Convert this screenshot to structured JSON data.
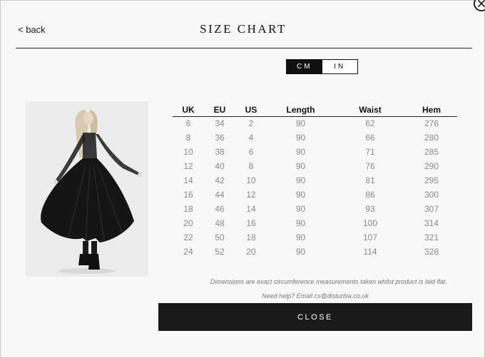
{
  "header": {
    "back_label": "< back",
    "title": "SIZE CHART"
  },
  "unit_toggle": {
    "options": [
      "CM",
      "IN"
    ],
    "selected": "CM"
  },
  "product_image": {
    "description_icon": "model-in-black-lace-dress-photo"
  },
  "table": {
    "columns": [
      "UK",
      "EU",
      "US",
      "Length",
      "Waist",
      "Hem"
    ],
    "rows": [
      [
        "6",
        "34",
        "2",
        "90",
        "62",
        "276"
      ],
      [
        "8",
        "36",
        "4",
        "90",
        "66",
        "280"
      ],
      [
        "10",
        "38",
        "6",
        "90",
        "71",
        "285"
      ],
      [
        "12",
        "40",
        "8",
        "90",
        "76",
        "290"
      ],
      [
        "14",
        "42",
        "10",
        "90",
        "81",
        "295"
      ],
      [
        "16",
        "44",
        "12",
        "90",
        "86",
        "300"
      ],
      [
        "18",
        "46",
        "14",
        "90",
        "93",
        "307"
      ],
      [
        "20",
        "48",
        "16",
        "90",
        "100",
        "314"
      ],
      [
        "22",
        "50",
        "18",
        "90",
        "107",
        "321"
      ],
      [
        "24",
        "52",
        "20",
        "90",
        "114",
        "328"
      ]
    ]
  },
  "notes": {
    "measurement": "Dimensions are exact circumference measurements taken whilst product is laid flat.",
    "help": "Need help? Email cs@disturbia.co.uk"
  },
  "footer": {
    "close_label": "CLOSE"
  },
  "colors": {
    "accent": "#111111",
    "muted_text": "#8a8a8a",
    "background": "#f8f8f8"
  }
}
